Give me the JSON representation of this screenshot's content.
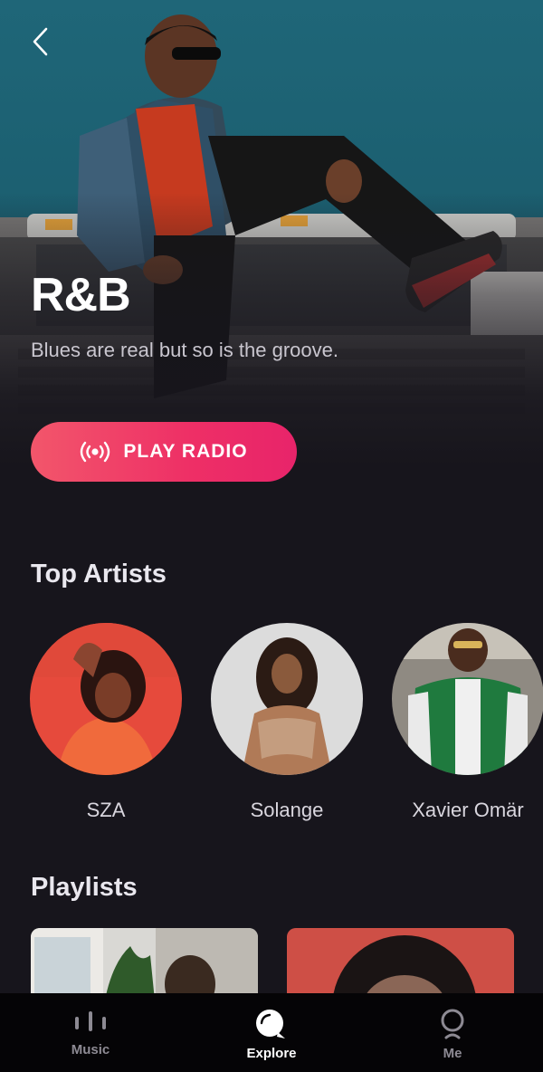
{
  "hero": {
    "title": "R&B",
    "subtitle": "Blues are real but so is the groove.",
    "play_radio_label": "PLAY RADIO"
  },
  "top_artists": {
    "heading": "Top Artists",
    "items": [
      {
        "name": "SZA"
      },
      {
        "name": "Solange"
      },
      {
        "name": "Xavier Omär"
      }
    ]
  },
  "playlists": {
    "heading": "Playlists"
  },
  "bottom_nav": {
    "tabs": [
      {
        "label": "Music",
        "icon": "equalizer-bars-icon",
        "active": false
      },
      {
        "label": "Explore",
        "icon": "explore-bubble-icon",
        "active": true
      },
      {
        "label": "Me",
        "icon": "profile-icon",
        "active": false
      }
    ]
  },
  "colors": {
    "background": "#17151c",
    "accent_start": "#f2566b",
    "accent_end": "#e8246a",
    "hero_sky": "#1f6678"
  }
}
